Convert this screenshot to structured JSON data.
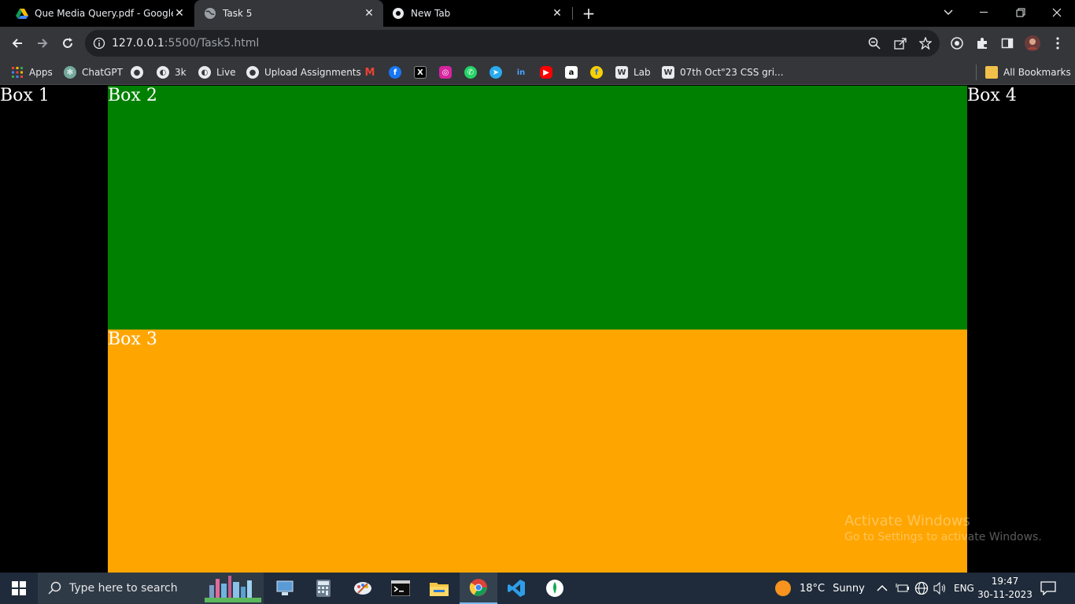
{
  "browser": {
    "tabs": [
      {
        "title": "Que Media Query.pdf - Google D",
        "icon": "google-drive-icon"
      },
      {
        "title": "Task 5",
        "icon": "globe-icon"
      },
      {
        "title": "New Tab",
        "icon": "chrome-icon"
      }
    ],
    "close_glyph": "✕",
    "new_tab_glyph": "+",
    "window_controls": {
      "minimize": "—",
      "restore": "❐",
      "close": "✕"
    },
    "url_host": "127.0.0.1",
    "url_rest": ":5500/Task5.html",
    "bookmarks": [
      {
        "label": "Apps",
        "icon": "apps-grid-icon"
      },
      {
        "label": "ChatGPT",
        "icon": "chatgpt-icon"
      },
      {
        "label": "",
        "icon": "github-icon"
      },
      {
        "label": "3k",
        "icon": "globe-icon"
      },
      {
        "label": "Live",
        "icon": "globe-icon"
      },
      {
        "label": "Upload Assignments",
        "icon": "github-icon"
      },
      {
        "label": "",
        "icon": "gmail-icon"
      },
      {
        "label": "",
        "icon": "facebook-icon"
      },
      {
        "label": "",
        "icon": "x-icon"
      },
      {
        "label": "",
        "icon": "instagram-icon"
      },
      {
        "label": "",
        "icon": "whatsapp-icon"
      },
      {
        "label": "",
        "icon": "telegram-icon"
      },
      {
        "label": "",
        "icon": "linkedin-icon"
      },
      {
        "label": "",
        "icon": "youtube-icon"
      },
      {
        "label": "",
        "icon": "amazon-icon"
      },
      {
        "label": "",
        "icon": "flipkart-icon"
      },
      {
        "label": "Lab",
        "icon": "page-icon"
      },
      {
        "label": "07th Oct\"23 CSS gri...",
        "icon": "page-icon"
      }
    ],
    "all_bookmarks": "All Bookmarks"
  },
  "page": {
    "box1": "Box 1",
    "box2": "Box 2",
    "box3": "Box 3",
    "box4": "Box 4",
    "colors": {
      "box2": "#008000",
      "box3": "#ffa500",
      "side": "#000000"
    }
  },
  "watermark": {
    "line1": "Activate Windows",
    "line2": "Go to Settings to activate Windows."
  },
  "taskbar": {
    "search_placeholder": "Type here to search",
    "weather_temp": "18°C",
    "weather_desc": "Sunny",
    "language": "ENG",
    "time": "19:47",
    "date": "30-11-2023"
  }
}
